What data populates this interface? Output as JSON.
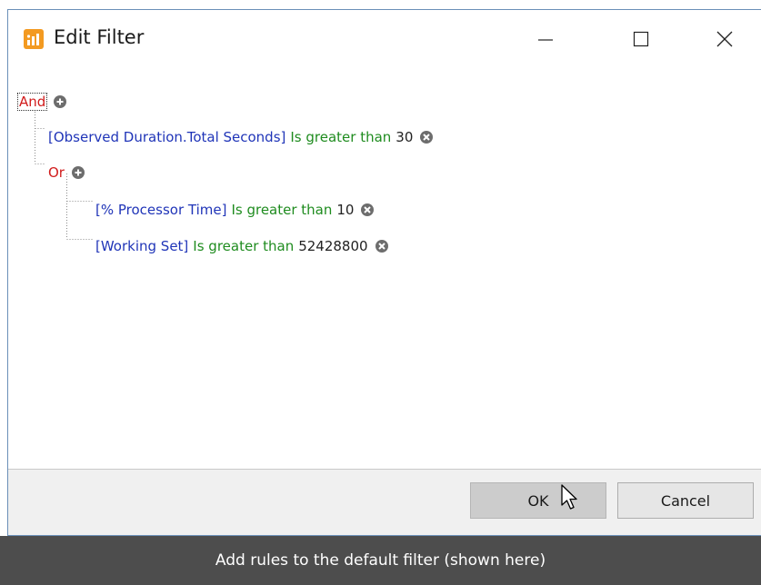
{
  "window": {
    "title": "Edit Filter",
    "icon": "chart-app-icon",
    "controls": [
      "minimize-icon",
      "maximize-icon",
      "close-icon"
    ]
  },
  "tree": {
    "root_group": "And",
    "rule1": {
      "field": "[Observed Duration.Total Seconds]",
      "operator": "Is greater than",
      "value": "30"
    },
    "subgroup": "Or",
    "rule2": {
      "field": "[% Processor Time]",
      "operator": "Is greater than",
      "value": "10"
    },
    "rule3": {
      "field": "[Working Set]",
      "operator": "Is greater than",
      "value": "52428800"
    }
  },
  "buttons": {
    "ok": "OK",
    "cancel": "Cancel"
  },
  "caption": "Add rules to the default filter (shown here)",
  "colors": {
    "group": "#d11b1b",
    "field": "#2035b8",
    "operator": "#1f8c1f",
    "value": "#222222",
    "accent": "#f39a21",
    "caption_bg": "#4d4d4d"
  }
}
